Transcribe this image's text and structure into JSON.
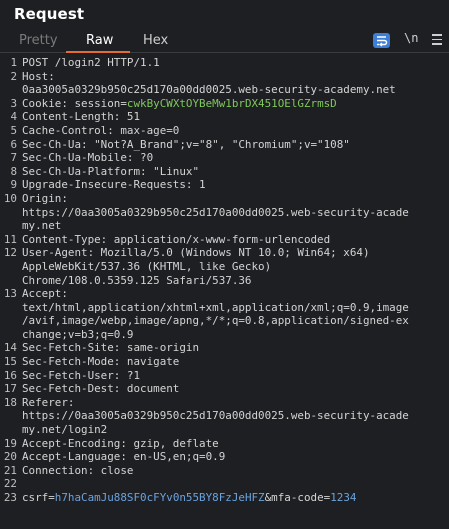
{
  "panel": {
    "title": "Request"
  },
  "tabs": [
    {
      "label": "Pretty",
      "state": "inactive"
    },
    {
      "label": "Raw",
      "state": "active"
    },
    {
      "label": "Hex",
      "state": "normal"
    }
  ],
  "toolbar": {
    "wrap_icon": "wrap-lines-icon",
    "newline_label": "\\n",
    "menu_icon": "hamburger-menu-icon",
    "wrap_color": "#3d7fd6",
    "accent": "#e86a33"
  },
  "lines": [
    {
      "n": "1",
      "text": "POST /login2 HTTP/1.1"
    },
    {
      "n": "2",
      "text": "Host:"
    },
    {
      "n": "",
      "text": "0aa3005a0329b950c25d170a00dd0025.web-security-academy.net"
    },
    {
      "n": "3",
      "text": "Cookie: session=",
      "cookie": "cwkByCWXtOYBeMw1brDX451OElGZrmsD"
    },
    {
      "n": "4",
      "text": "Content-Length: 51"
    },
    {
      "n": "5",
      "text": "Cache-Control: max-age=0"
    },
    {
      "n": "6",
      "text": "Sec-Ch-Ua: \"Not?A_Brand\";v=\"8\", \"Chromium\";v=\"108\""
    },
    {
      "n": "7",
      "text": "Sec-Ch-Ua-Mobile: ?0"
    },
    {
      "n": "8",
      "text": "Sec-Ch-Ua-Platform: \"Linux\""
    },
    {
      "n": "9",
      "text": "Upgrade-Insecure-Requests: 1"
    },
    {
      "n": "10",
      "text": "Origin:"
    },
    {
      "n": "",
      "text": "https://0aa3005a0329b950c25d170a00dd0025.web-security-acade"
    },
    {
      "n": "",
      "text": "my.net"
    },
    {
      "n": "11",
      "text": "Content-Type: application/x-www-form-urlencoded"
    },
    {
      "n": "12",
      "text": "User-Agent: Mozilla/5.0 (Windows NT 10.0; Win64; x64)"
    },
    {
      "n": "",
      "text": "AppleWebKit/537.36 (KHTML, like Gecko)"
    },
    {
      "n": "",
      "text": "Chrome/108.0.5359.125 Safari/537.36"
    },
    {
      "n": "13",
      "text": "Accept:"
    },
    {
      "n": "",
      "text": "text/html,application/xhtml+xml,application/xml;q=0.9,image"
    },
    {
      "n": "",
      "text": "/avif,image/webp,image/apng,*/*;q=0.8,application/signed-ex"
    },
    {
      "n": "",
      "text": "change;v=b3;q=0.9"
    },
    {
      "n": "14",
      "text": "Sec-Fetch-Site: same-origin"
    },
    {
      "n": "15",
      "text": "Sec-Fetch-Mode: navigate"
    },
    {
      "n": "16",
      "text": "Sec-Fetch-User: ?1"
    },
    {
      "n": "17",
      "text": "Sec-Fetch-Dest: document"
    },
    {
      "n": "18",
      "text": "Referer:"
    },
    {
      "n": "",
      "text": "https://0aa3005a0329b950c25d170a00dd0025.web-security-acade"
    },
    {
      "n": "",
      "text": "my.net/login2"
    },
    {
      "n": "19",
      "text": "Accept-Encoding: gzip, deflate"
    },
    {
      "n": "20",
      "text": "Accept-Language: en-US,en;q=0.9"
    },
    {
      "n": "21",
      "text": "Connection: close"
    },
    {
      "n": "22",
      "text": ""
    },
    {
      "n": "23",
      "text": "",
      "body": [
        {
          "k": "csrf=",
          "v": "h7haCamJu88SF0cFYv0n55BY8FzJeHFZ"
        },
        {
          "k": "&mfa-code=",
          "v": "1234"
        }
      ]
    }
  ]
}
